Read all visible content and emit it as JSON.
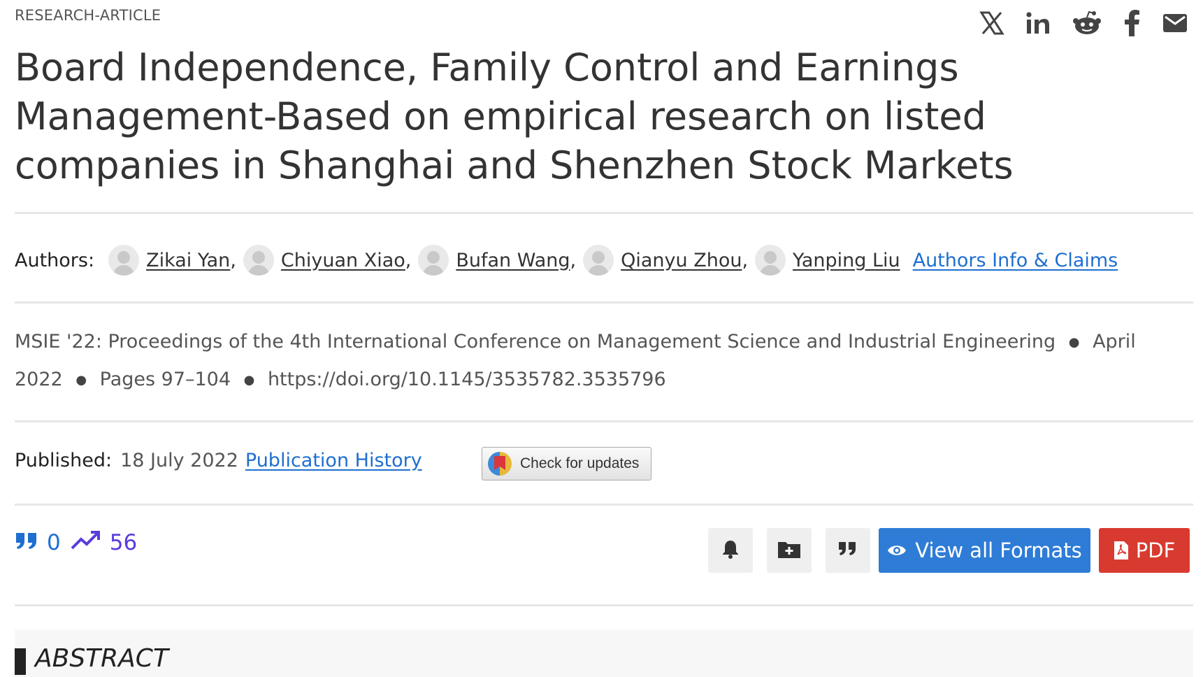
{
  "article": {
    "type_label": "RESEARCH-ARTICLE",
    "title": "Board Independence, Family Control and Earnings Management-Based on empirical research on listed companies in Shanghai and Shenzhen Stock Markets"
  },
  "share_icons": [
    "x-twitter-icon",
    "linkedin-icon",
    "reddit-icon",
    "facebook-icon",
    "email-icon"
  ],
  "authors": {
    "label": "Authors:",
    "names": [
      "Zikai Yan",
      "Chiyuan Xiao",
      "Bufan Wang",
      "Qianyu Zhou",
      "Yanping Liu"
    ],
    "separator": ",",
    "info_link": "Authors Info & Claims"
  },
  "meta": {
    "proceedings": "MSIE '22: Proceedings of the 4th International Conference on Management Science and Industrial Engineering",
    "date": "April 2022",
    "pages": "Pages 97–104",
    "doi": "https://doi.org/10.1145/3535782.3535796"
  },
  "published": {
    "label": "Published:",
    "date": "18 July 2022",
    "history_link": "Publication History"
  },
  "check_updates": {
    "label": "Check for updates"
  },
  "metrics": {
    "citations": "0",
    "downloads": "56"
  },
  "actions": {
    "view_formats": "View all Formats",
    "pdf": "PDF"
  },
  "abstract": {
    "heading": "ABSTRACT"
  },
  "colors": {
    "link": "#1e6fd0",
    "downloads": "#5b3cdd",
    "view_formats_bg": "#2e7cd6",
    "pdf_bg": "#d93a2f"
  }
}
